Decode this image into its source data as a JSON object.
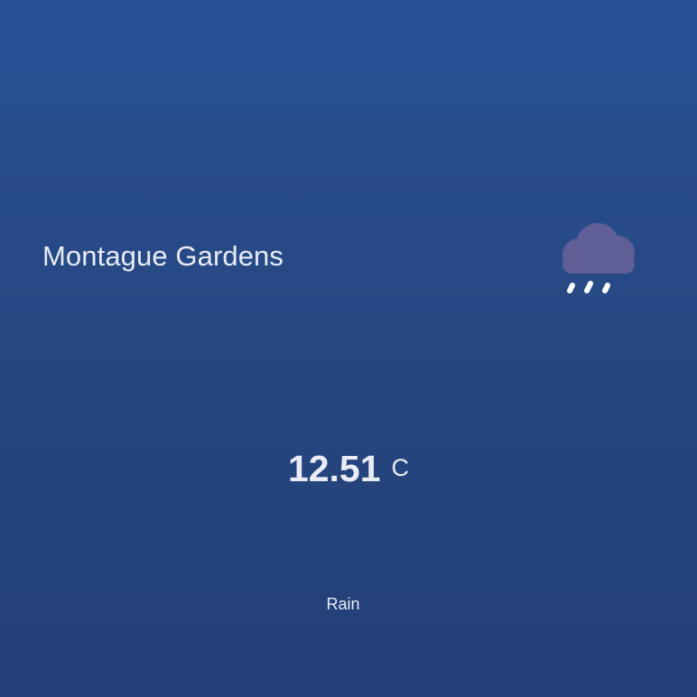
{
  "location": {
    "name": "Montague Gardens"
  },
  "weather": {
    "icon": "rain-cloud-icon",
    "temperature": "12.51",
    "unit": "C",
    "condition": "Rain"
  },
  "colors": {
    "background_top": "#295296",
    "background_bottom": "#233f77",
    "cloud": "#5f5e97",
    "rain": "#ffffff",
    "text": "#e9ecf5"
  }
}
